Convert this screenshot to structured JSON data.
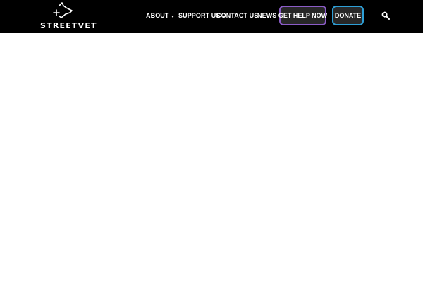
{
  "brand": {
    "name": "STREETVET",
    "logo_icon": "dog-head-cross-icon"
  },
  "nav": {
    "items": [
      {
        "label": "ABOUT",
        "has_dropdown": true
      },
      {
        "label": "SUPPORT US",
        "has_dropdown": true
      },
      {
        "label": "CONTACT US",
        "has_dropdown": true
      },
      {
        "label": "NEWS",
        "has_dropdown": false
      }
    ]
  },
  "actions": {
    "get_help_label": "GET HELP NOW",
    "donate_label": "DONATE",
    "search_icon": "search-icon"
  },
  "colors": {
    "header_bg": "#000000",
    "button_bg": "#272727",
    "get_help_border": "#8b5cc7",
    "donate_border": "#2e9fd6",
    "page_bg": "#ffffff"
  }
}
